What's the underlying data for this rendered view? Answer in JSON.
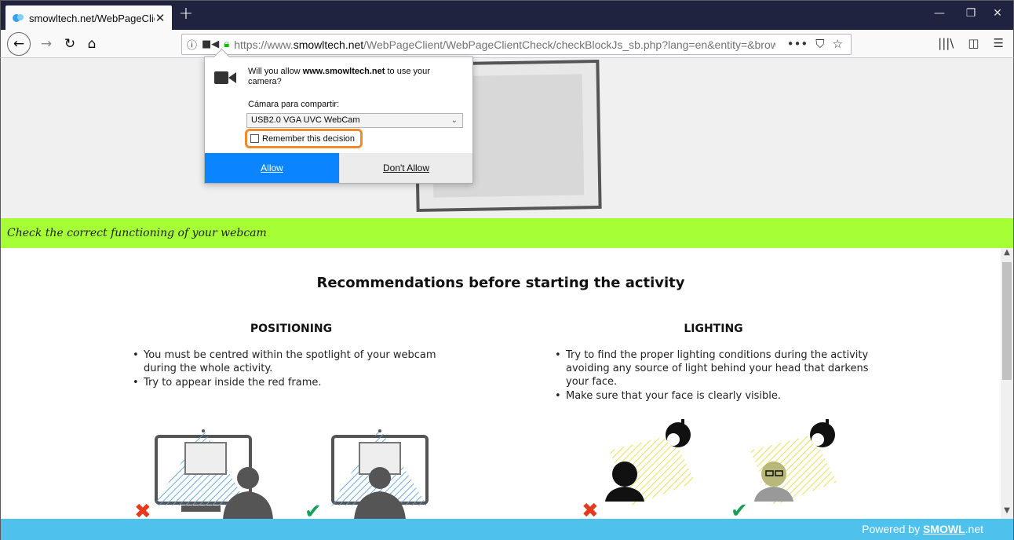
{
  "browser": {
    "tab": {
      "title": "smowltech.net/WebPageClient",
      "close_glyph": "✕"
    },
    "new_tab_glyph": "+",
    "window_controls": {
      "minimize": "—",
      "restore": "❐",
      "close": "✕"
    },
    "url": {
      "prefix": "https://www.",
      "host": "smowltech.net",
      "path": "/WebPageClient/WebPageClientCheck/checkBlockJs_sb.php?lang=en&entity=&browser="
    },
    "url_actions": {
      "more": "•••",
      "pocket": "⛉",
      "bookmark": "☆"
    },
    "tools": {
      "library": "|||\\",
      "sidebar": "◫",
      "menu": "☰"
    }
  },
  "popup": {
    "message_before": "Will you allow ",
    "message_host": "www.smowltech.net",
    "message_after": " to use your camera?",
    "camera_label": "Cámara para compartir:",
    "camera_selected": "USB2.0 VGA UVC WebCam",
    "remember_label": "Remember this decision",
    "allow_label": "Allow",
    "deny_label": "Don't Allow"
  },
  "page": {
    "banner_text": "Check the correct functioning of your webcam",
    "recommendations_title": "Recommendations before starting the activity",
    "positioning": {
      "title": "POSITIONING",
      "bullets": [
        "You must be centred within the spotlight of your webcam during the whole activity.",
        "Try to appear inside the red frame."
      ]
    },
    "lighting": {
      "title": "LIGHTING",
      "bullets": [
        "Try to find the proper lighting conditions during the activity avoiding any source of light behind your head that darkens your face.",
        "Make sure that your face is clearly visible."
      ]
    },
    "footer": {
      "prefix": "Powered by ",
      "brand": "SMOWL",
      "suffix": ".net"
    }
  },
  "colors": {
    "titlebar": "#202340",
    "banner": "#a6ff35",
    "footer": "#4ec2ec",
    "allow_button": "#0a84ff",
    "highlight": "#ef8a2d",
    "wrong_mark": "#e53a1e",
    "right_mark": "#1a9e5b"
  }
}
